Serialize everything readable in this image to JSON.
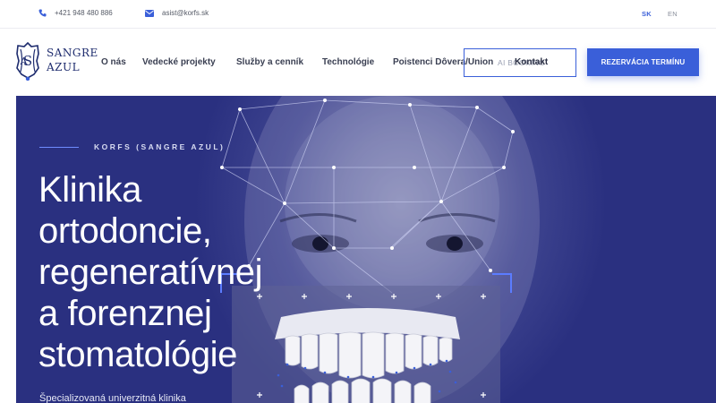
{
  "topbar": {
    "phone": "+421 948 480 886",
    "email": "asist@korfs.sk",
    "phone_icon": "phone-icon",
    "email_icon": "mail-icon",
    "languages": [
      "SK",
      "EN"
    ],
    "active_language": "SK"
  },
  "header": {
    "logo_line1": "SANGRE",
    "logo_line2": "AZUL",
    "nav": [
      "O nás",
      "Vedecké projekty",
      "Služby a cenník",
      "Technológie",
      "Poistenci Dôvera/Union"
    ],
    "contact_ghost": "AI BOOKING",
    "contact_label": "Kontakt",
    "reserve_label": "REZERVÁCIA TERMÍNU"
  },
  "hero": {
    "eyebrow": "KORFS (SANGRE AZUL)",
    "headline": [
      "Klinika",
      "ortodoncie,",
      "regeneratívnej",
      "a forenznej",
      "stomatológie"
    ],
    "subtitle": "Špecializovaná univerzitná klinika"
  },
  "colors": {
    "accent": "#3a5fd9",
    "hero_bg": "#2a3080",
    "logo": "#1e2c6e"
  }
}
